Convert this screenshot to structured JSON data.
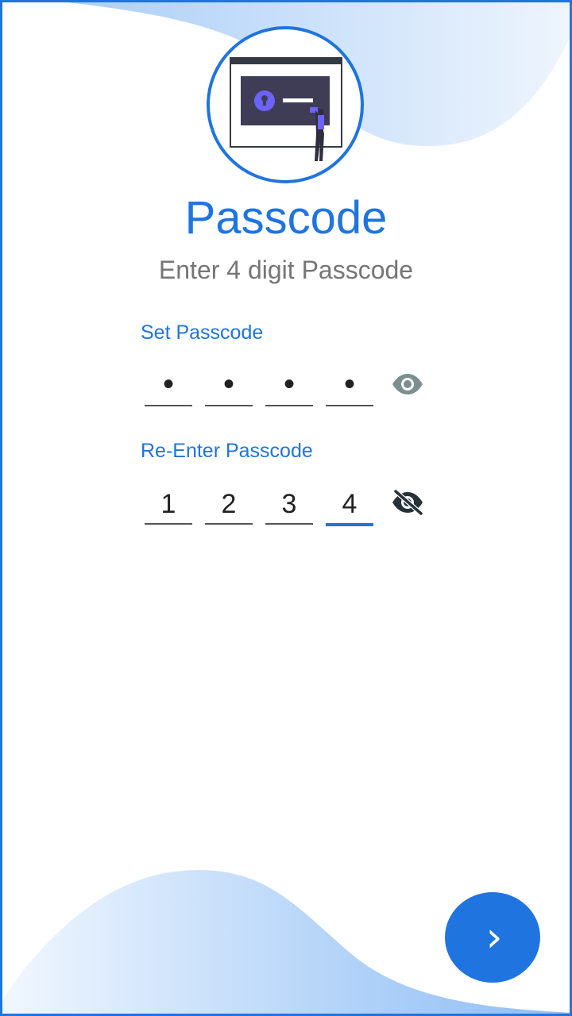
{
  "header": {
    "title": "Passcode",
    "subtitle": "Enter 4 digit Passcode",
    "illustration_icon": "lock-screen-illustration"
  },
  "set_passcode": {
    "label": "Set Passcode",
    "digits": [
      "•",
      "•",
      "•",
      "•"
    ],
    "masked": true,
    "toggle_icon": "eye-icon"
  },
  "reenter_passcode": {
    "label": "Re-Enter Passcode",
    "digits": [
      "1",
      "2",
      "3",
      "4"
    ],
    "masked": false,
    "active_index": 3,
    "toggle_icon": "eye-off-icon"
  },
  "next_button": {
    "icon": "chevron-right-icon",
    "glyph": "›"
  },
  "colors": {
    "accent": "#1f74df",
    "subtitle": "#757575",
    "wave_light": "#dbe9fb",
    "wave_mid": "#a9cdf7"
  }
}
